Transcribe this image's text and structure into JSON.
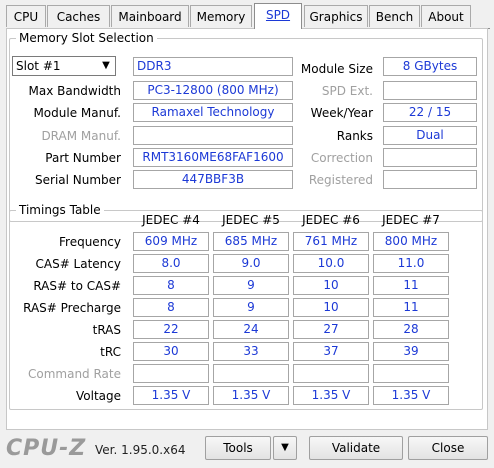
{
  "tabs": [
    "CPU",
    "Caches",
    "Mainboard",
    "Memory",
    "SPD",
    "Graphics",
    "Bench",
    "About"
  ],
  "active_tab": "SPD",
  "memory_slot": {
    "group_title": "Memory Slot Selection",
    "slot_value": "Slot #1",
    "type": "DDR3",
    "labels": {
      "max_bandwidth": "Max Bandwidth",
      "module_manuf": "Module Manuf.",
      "dram_manuf": "DRAM Manuf.",
      "part_number": "Part Number",
      "serial_number": "Serial Number",
      "module_size": "Module Size",
      "spd_ext": "SPD Ext.",
      "week_year": "Week/Year",
      "ranks": "Ranks",
      "correction": "Correction",
      "registered": "Registered"
    },
    "values": {
      "max_bandwidth": "PC3-12800 (800 MHz)",
      "module_manuf": "Ramaxel Technology",
      "dram_manuf": "",
      "part_number": "RMT3160ME68FAF1600",
      "serial_number": "447BBF3B",
      "module_size": "8 GBytes",
      "spd_ext": "",
      "week_year": "22 / 15",
      "ranks": "Dual",
      "correction": "",
      "registered": ""
    }
  },
  "timings": {
    "group_title": "Timings Table",
    "headers": [
      "JEDEC #4",
      "JEDEC #5",
      "JEDEC #6",
      "JEDEC #7"
    ],
    "rows": [
      {
        "label": "Frequency",
        "values": [
          "609 MHz",
          "685 MHz",
          "761 MHz",
          "800 MHz"
        ]
      },
      {
        "label": "CAS# Latency",
        "values": [
          "8.0",
          "9.0",
          "10.0",
          "11.0"
        ]
      },
      {
        "label": "RAS# to CAS#",
        "values": [
          "8",
          "9",
          "10",
          "11"
        ]
      },
      {
        "label": "RAS# Precharge",
        "values": [
          "8",
          "9",
          "10",
          "11"
        ]
      },
      {
        "label": "tRAS",
        "values": [
          "22",
          "24",
          "27",
          "28"
        ]
      },
      {
        "label": "tRC",
        "values": [
          "30",
          "33",
          "37",
          "39"
        ]
      },
      {
        "label": "Command Rate",
        "values": [
          "",
          "",
          "",
          ""
        ]
      },
      {
        "label": "Voltage",
        "values": [
          "1.35 V",
          "1.35 V",
          "1.35 V",
          "1.35 V"
        ]
      }
    ]
  },
  "footer": {
    "logo": "CPU-Z",
    "version": "Ver. 1.95.0.x64",
    "tools": "Tools",
    "validate": "Validate",
    "close": "Close"
  }
}
